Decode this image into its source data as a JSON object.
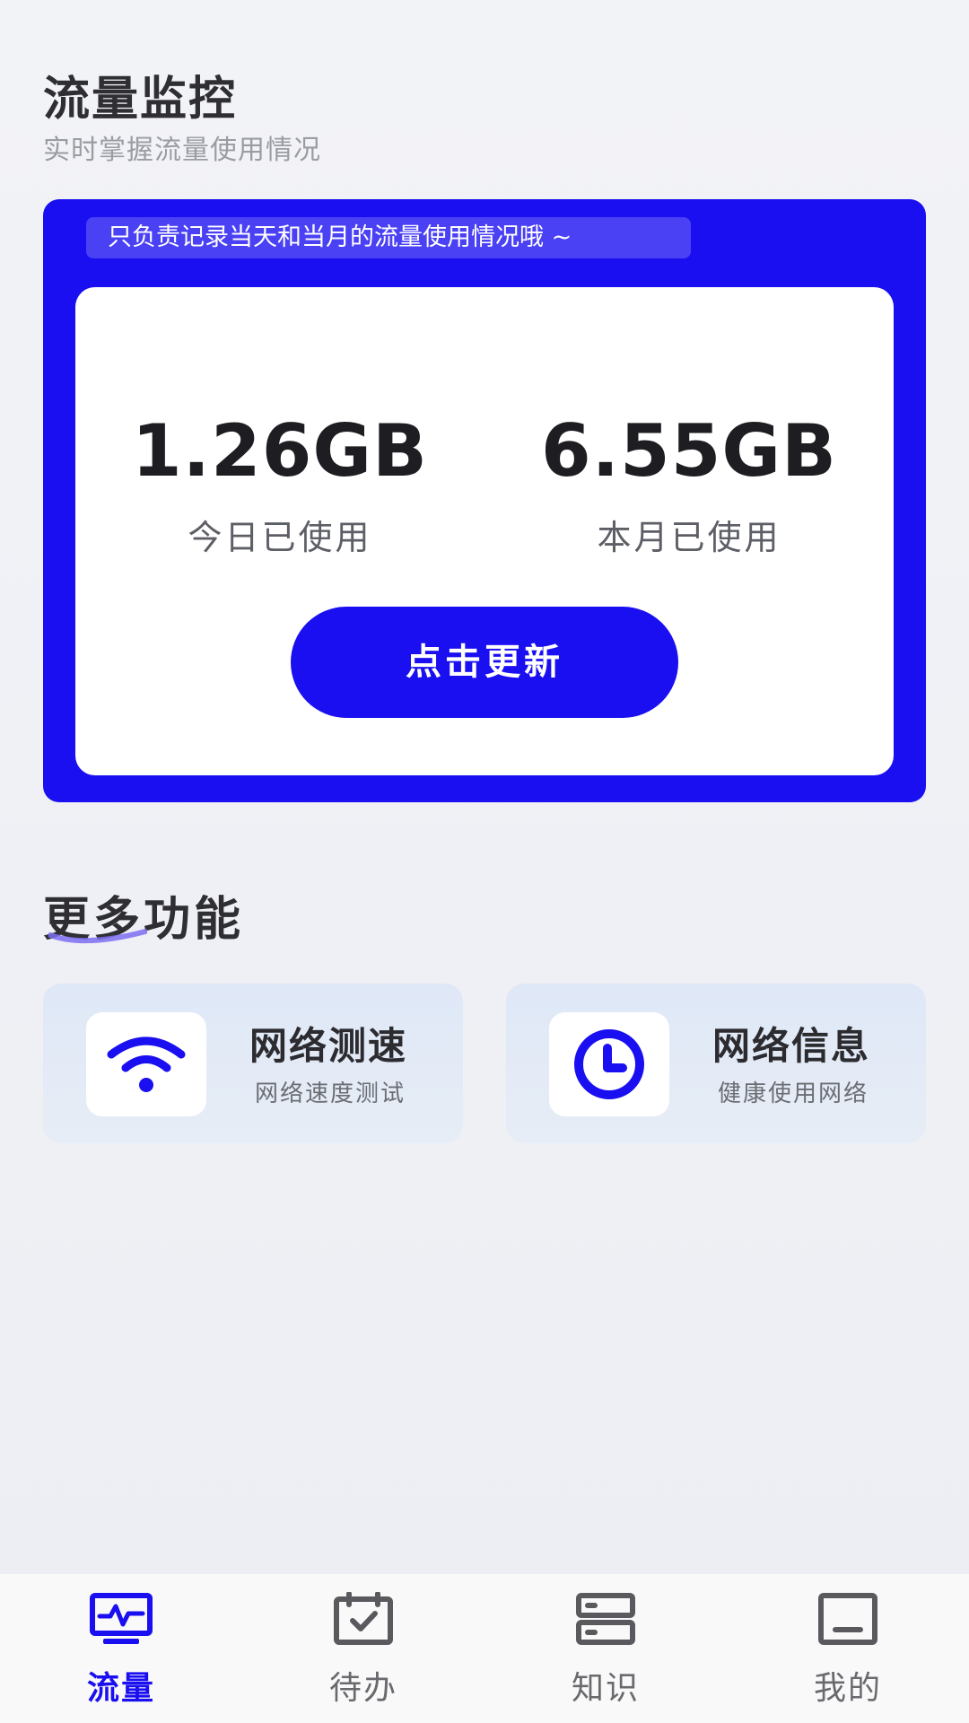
{
  "header": {
    "title": "流量监控",
    "subtitle": "实时掌握流量使用情况"
  },
  "usage": {
    "notice": "只负责记录当天和当月的流量使用情况哦 ~",
    "today_value": "1.26GB",
    "today_label": "今日已使用",
    "month_value": "6.55GB",
    "month_label": "本月已使用",
    "refresh_label": "点击更新"
  },
  "more": {
    "title": "更多功能",
    "features": [
      {
        "title": "网络测速",
        "subtitle": "网络速度测试",
        "icon": "wifi-icon"
      },
      {
        "title": "网络信息",
        "subtitle": "健康使用网络",
        "icon": "clock-icon"
      }
    ]
  },
  "nav": {
    "items": [
      {
        "label": "流量",
        "icon": "monitor-pulse-icon",
        "active": true
      },
      {
        "label": "待办",
        "icon": "calendar-check-icon",
        "active": false
      },
      {
        "label": "知识",
        "icon": "server-icon",
        "active": false
      },
      {
        "label": "我的",
        "icon": "profile-box-icon",
        "active": false
      }
    ]
  },
  "colors": {
    "accent": "#1a0ff0",
    "notice_bg": "#4a40f4",
    "page_bg": "#eef0f5",
    "text_dark": "#2f2f33",
    "text_muted": "#9a9ca3",
    "nav_inactive": "#6a6a6e"
  }
}
